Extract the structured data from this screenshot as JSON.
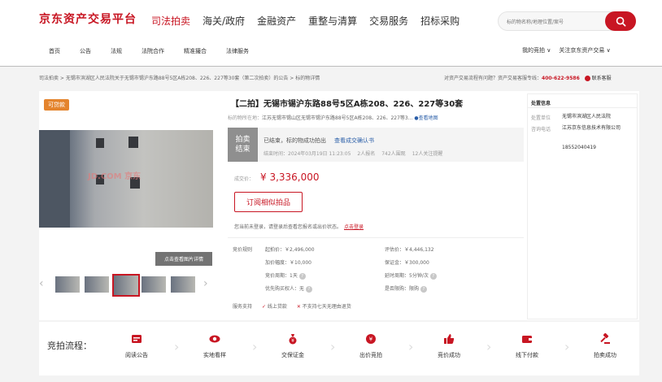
{
  "header": {
    "logo": "京东资产交易平台",
    "nav": [
      "司法拍卖",
      "海关/政府",
      "金融资产",
      "重整与清算",
      "交易服务",
      "招标采购"
    ],
    "search_placeholder": "标的物名称/地理位置/案号",
    "subnav": [
      "首页",
      "公告",
      "法规",
      "法院合作",
      "精准撮合",
      "法律服务"
    ],
    "my_bids": "我的竞拍 ∨",
    "follow": "关注京东资产交易 ∨"
  },
  "breadcrumb": "司法拍卖 > 无锡市滨湖区人民法院关于无锡市锡沪东路88号5区A栋208、226、227等30套（第二次拍卖）的公告 > 标的物详情",
  "help": {
    "question": "对资产交易流程有问题？资产交易客服专线：",
    "phone": "400-622-9586",
    "cs": "联系客服"
  },
  "gallery": {
    "tag": "可贷款",
    "watermark": "JD.COM 京东",
    "view_button": "点击查看图片详情"
  },
  "item": {
    "title": "【二拍】无锡市锡沪东路88号5区A栋208、226、227等30套",
    "location_label": "标的物所在地：",
    "location": "江苏无锡市锡山区无锡市锡沪东路88号5区A栋208、226、227等3...",
    "map_link": "查看地图"
  },
  "status": {
    "tag_line1": "拍卖",
    "tag_line2": "结束",
    "result": "已结束，标的物成功拍出",
    "confirm_link": "查看成交确认书",
    "end_time": "结束时间：2024年03月19日 11:23:05",
    "bidders": "2人报名",
    "views": "742人围观",
    "watchers": "12人关注提醒"
  },
  "price": {
    "label": "成交价：",
    "value": "¥ 3,336,000",
    "subscribe": "订阅相似拍品",
    "note": "您当前未登录，请登录后查看您报名或出价状态。",
    "login": "点击登录"
  },
  "params": {
    "section_label": "竞价规则",
    "start_price": "起拍价：￥2,496,000",
    "eval_price": "评估价：￥4,446,132",
    "increment": "加价幅度：￥10,000",
    "deposit": "保证金：￥300,000",
    "cycle": "竞价周期：1天",
    "extension": "延时周期：5分钟/次",
    "priority": "优先购买权人：无",
    "purchase_limit": "是否限购：限购"
  },
  "service": {
    "label": "服务支持",
    "loan": "线上贷款",
    "no_return": "不支持七天无理由退货"
  },
  "dispose": {
    "title": "处置信息",
    "unit_label": "处置单位",
    "unit": "无锡市滨湖区人民法院",
    "phone_label": "咨询电话",
    "company": "江苏京东信息技术有限公司",
    "phone": "18552040419"
  },
  "flow": {
    "label": "竞拍流程：",
    "steps": [
      "阅读公告",
      "实地看样",
      "交保证金",
      "出价竞拍",
      "竞价成功",
      "线下付款",
      "拍卖成功"
    ]
  },
  "colors": {
    "brand": "#c81623",
    "tag": "#e4842d",
    "status_gray": "#8f8f8f"
  }
}
